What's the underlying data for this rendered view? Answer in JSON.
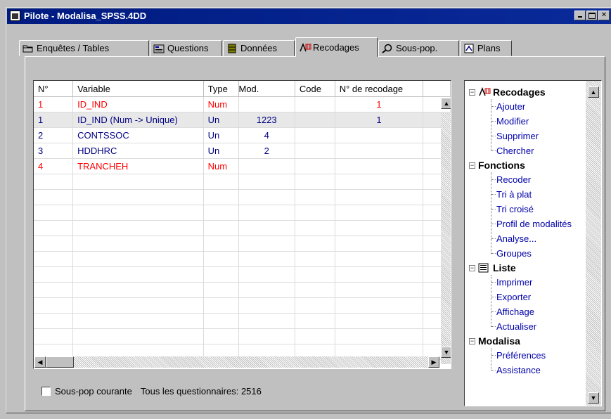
{
  "window": {
    "title": "Pilote - Modalisa_SPSS.4DD",
    "controls": [
      "minimize",
      "maximize",
      "close"
    ]
  },
  "tabs": [
    {
      "label": "Enquêtes / Tables",
      "icon": "folder-icon",
      "active": false
    },
    {
      "label": "Questions",
      "icon": "questions-icon",
      "active": false
    },
    {
      "label": "Données",
      "icon": "database-icon",
      "active": false
    },
    {
      "label": "Recodages",
      "icon": "recode-icon",
      "active": true
    },
    {
      "label": "Sous-pop.",
      "icon": "magnifier-icon",
      "active": false
    },
    {
      "label": "Plans",
      "icon": "plans-icon",
      "active": false
    }
  ],
  "grid": {
    "headers": [
      "N°",
      "Variable",
      "Type",
      "Mod.",
      "Code",
      "N° de recodage"
    ],
    "rows": [
      {
        "n": "1",
        "variable": "ID_IND",
        "type": "Num",
        "mod": "",
        "code": "",
        "recodage": "1",
        "color": "#ff0000",
        "selected": false
      },
      {
        "n": "1",
        "variable": "ID_IND (Num -> Unique)",
        "type": "Un",
        "mod": "1223",
        "code": "",
        "recodage": "1",
        "color": "#000080",
        "selected": true
      },
      {
        "n": "2",
        "variable": "CONTSSOC",
        "type": "Un",
        "mod": "4",
        "code": "",
        "recodage": "",
        "color": "#000080",
        "selected": false
      },
      {
        "n": "3",
        "variable": "HDDHRC",
        "type": "Un",
        "mod": "2",
        "code": "",
        "recodage": "",
        "color": "#000080",
        "selected": false
      },
      {
        "n": "4",
        "variable": "TRANCHEH",
        "type": "Num",
        "mod": "",
        "code": "",
        "recodage": "",
        "color": "#ff0000",
        "selected": false
      }
    ]
  },
  "status": {
    "checkbox_label": "Sous-pop courante",
    "checkbox_checked": false,
    "questionnaires": "Tous les questionnaires: 2516"
  },
  "tree": {
    "groups": [
      {
        "label": "Recodages",
        "icon": "recode-icon",
        "items": [
          "Ajouter",
          "Modifier",
          "Supprimer",
          "Chercher"
        ]
      },
      {
        "label": "Fonctions",
        "icon": "",
        "items": [
          "Recoder",
          "Tri à plat",
          "Tri croisé",
          "Profil de modalités",
          "Analyse...",
          "Groupes"
        ]
      },
      {
        "label": "Liste",
        "icon": "list-icon",
        "items": [
          "Imprimer",
          "Exporter",
          "Affichage",
          "Actualiser"
        ]
      },
      {
        "label": "Modalisa",
        "icon": "",
        "items": [
          "Préférences",
          "Assistance"
        ]
      }
    ]
  }
}
